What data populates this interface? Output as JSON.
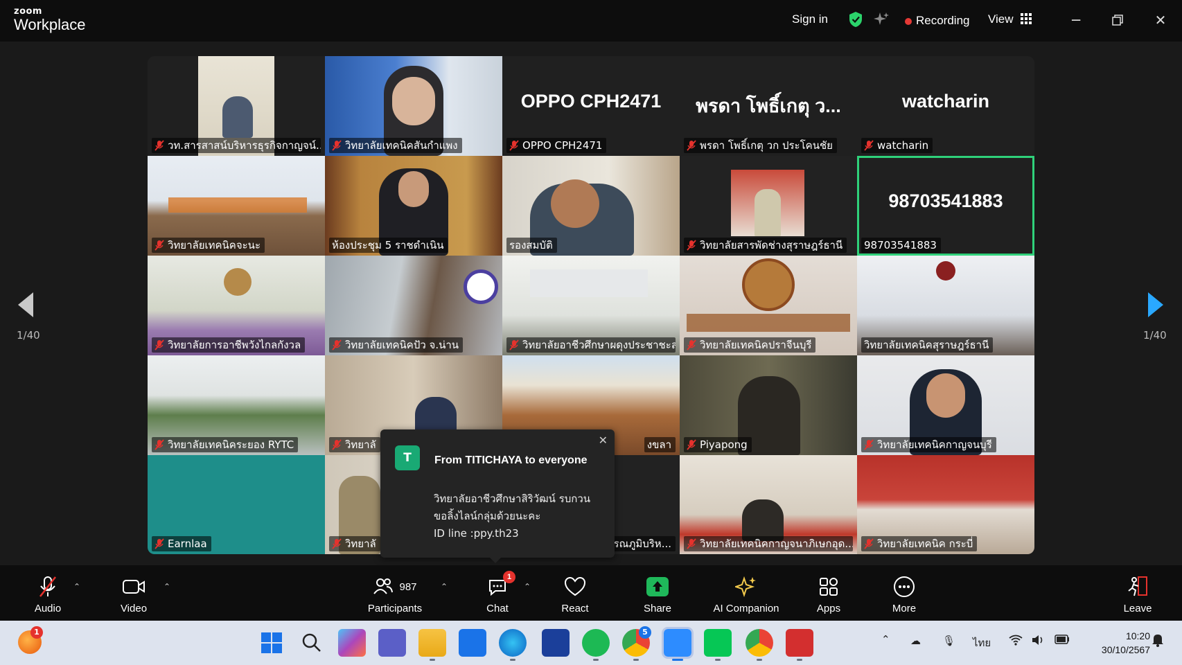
{
  "window": {
    "brand_small": "zoom",
    "brand_big": "Workplace",
    "sign_in": "Sign in",
    "recording": "Recording",
    "view": "View"
  },
  "pagination": {
    "left": "1/40",
    "right": "1/40"
  },
  "tiles": [
    {
      "label": "วท.สารสาสน์บริหารธุรกิจกาญจน์...",
      "big": "",
      "muted": true
    },
    {
      "label": "วิทยาลัยเทคนิคสันกำแพง",
      "big": "",
      "muted": true
    },
    {
      "label": "OPPO CPH2471",
      "big": "OPPO CPH2471",
      "muted": true
    },
    {
      "label": "พรดา โพธิ์เกตุ วก ประโคนชัย",
      "big": "พรดา โพธิ์เกตุ ว...",
      "muted": true
    },
    {
      "label": "watcharin",
      "big": "watcharin",
      "muted": true
    },
    {
      "label": "วิทยาลัยเทคนิคจะนะ",
      "big": "",
      "muted": true
    },
    {
      "label": "ห้องประชุม 5 ราชดำเนิน",
      "big": "",
      "muted": false
    },
    {
      "label": "รองสมบัติ",
      "big": "",
      "muted": false
    },
    {
      "label": "วิทยาลัยสารพัดช่างสุราษฎร์ธานี",
      "big": "",
      "muted": true
    },
    {
      "label": "98703541883",
      "big": "98703541883",
      "muted": false
    },
    {
      "label": "วิทยาลัยการอาชีพวังไกลกังวล",
      "big": "",
      "muted": true
    },
    {
      "label": "วิทยาลัยเทคนิคปัว จ.น่าน",
      "big": "",
      "muted": true
    },
    {
      "label": "วิทยาลัยอาชีวศึกษาผดุงประชาชะลา",
      "big": "",
      "muted": true
    },
    {
      "label": "วิทยาลัยเทคนิคปราจีนบุรี",
      "big": "",
      "muted": true
    },
    {
      "label": "วิทยาลัยเทคนิคสุราษฎร์ธานี",
      "big": "",
      "muted": false
    },
    {
      "label": "วิทยาลัยเทคนิคระยอง RYTC",
      "big": "",
      "muted": true
    },
    {
      "label": "วิทยาลั",
      "big": "",
      "muted": true
    },
    {
      "label": "งขลา",
      "big": "",
      "muted": false
    },
    {
      "label": "Piyapong",
      "big": "",
      "muted": true
    },
    {
      "label": "วิทยาลัยเทคนิคกาญจนบุรี",
      "big": "",
      "muted": true
    },
    {
      "label": "Earnlaa",
      "big": "",
      "muted": true
    },
    {
      "label": "วิทยาลั",
      "big": "",
      "muted": true
    },
    {
      "label": "รรณภูมิบริห...",
      "big": "",
      "muted": false
    },
    {
      "label": "วิทยาลัยเทคนิคกาญจนาภิเษกอุด...",
      "big": "",
      "muted": true
    },
    {
      "label": "วิทยาลัยเทคนิค กระบี่",
      "big": "",
      "muted": true
    }
  ],
  "chat_popup": {
    "avatar": "T",
    "from": "From TITICHAYA to everyone",
    "line1": "วิทยาลัยอาชีวศึกษาสิริวัฒน์ รบกวน",
    "line2": "ขอลิ้งไลน์กลุ่มด้วยนะคะ",
    "line3": "ID line :ppy.th23"
  },
  "toolbar": {
    "audio": "Audio",
    "video": "Video",
    "participants": "Participants",
    "participants_count": "987",
    "chat": "Chat",
    "chat_badge": "1",
    "react": "React",
    "share": "Share",
    "ai": "AI Companion",
    "apps": "Apps",
    "more": "More",
    "leave": "Leave"
  },
  "taskbar": {
    "notif_badge": "1",
    "chrome_badge": "5",
    "lang": "ไทย",
    "time": "10:20",
    "date": "30/10/2567"
  },
  "colors": {
    "accent_green": "#2fd17a",
    "share_green": "#1fb85a",
    "record_red": "#e53935",
    "mute_red": "#e5322d"
  }
}
